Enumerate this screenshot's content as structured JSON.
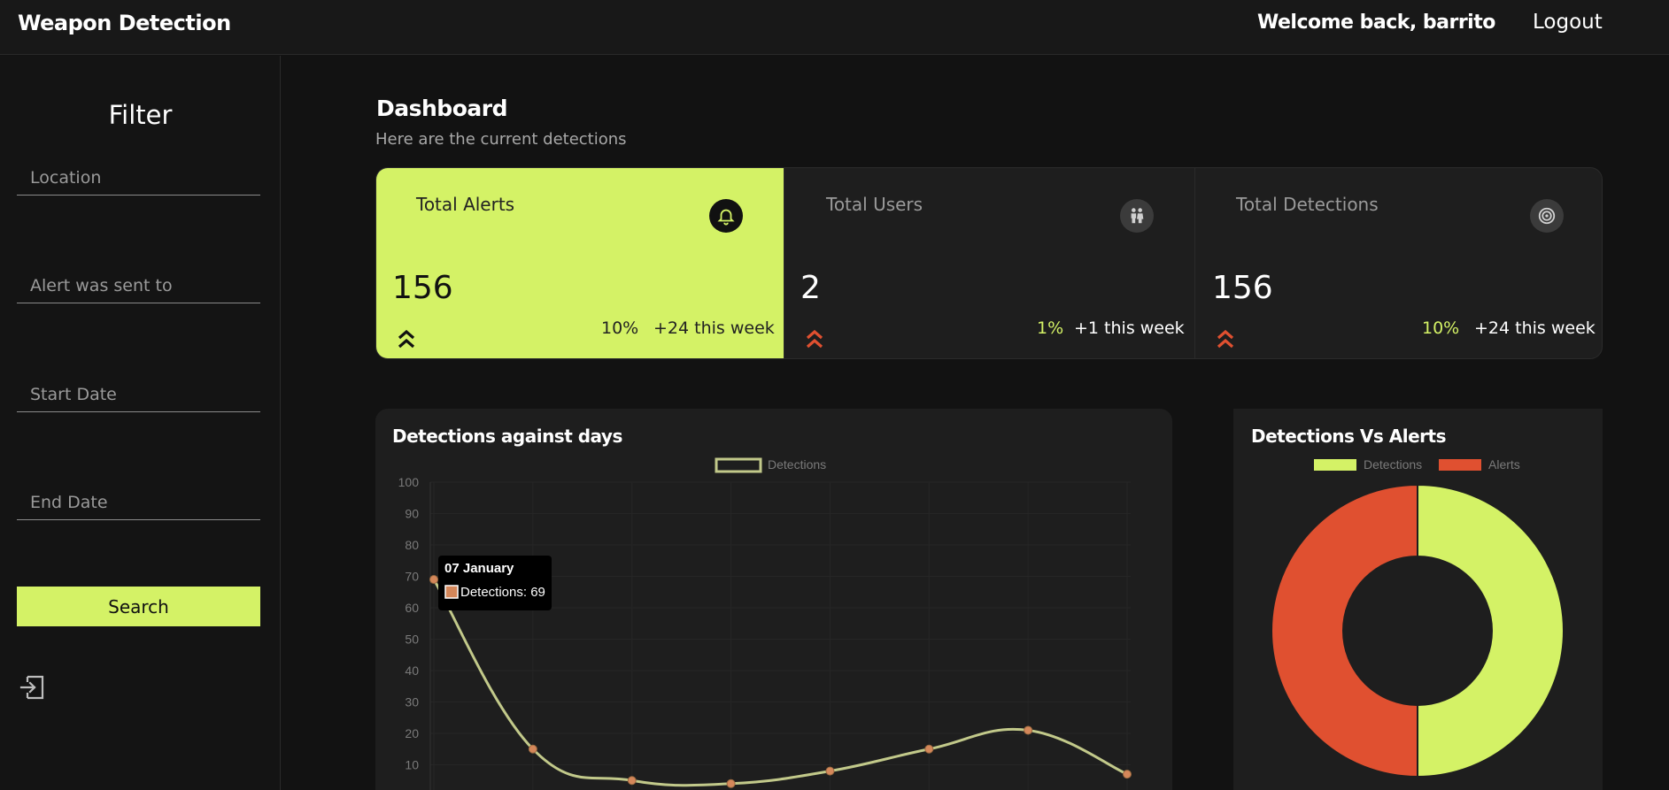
{
  "header": {
    "brand": "Weapon Detection",
    "welcome": "Welcome back, barrito",
    "logout": "Logout"
  },
  "sidebar": {
    "title": "Filter",
    "fields": [
      {
        "placeholder": "Location",
        "value": ""
      },
      {
        "placeholder": "Alert was sent to",
        "value": ""
      },
      {
        "placeholder": "Start Date",
        "value": ""
      },
      {
        "placeholder": "End Date",
        "value": ""
      }
    ],
    "search_label": "Search",
    "exit_icon": "sign-in-icon"
  },
  "main": {
    "title": "Dashboard",
    "subtitle": "Here are the current detections"
  },
  "stats": [
    {
      "label": "Total Alerts",
      "value": "156",
      "pct": "10%",
      "week": "+24 this week",
      "icon": "bell-icon",
      "trend": "double-chevron-up-icon"
    },
    {
      "label": "Total Users",
      "value": "2",
      "pct": "1%",
      "week": "+1 this week",
      "icon": "users-icon",
      "trend": "double-chevron-up-icon"
    },
    {
      "label": "Total Detections",
      "value": "156",
      "pct": "10%",
      "week": "+24 this week",
      "icon": "target-icon",
      "trend": "double-chevron-up-icon"
    }
  ],
  "colors": {
    "accent": "#d4f266",
    "alert": "#e05030",
    "line": "#c2c98a",
    "point": "#d4875a"
  },
  "line_panel": {
    "title": "Detections against days",
    "tooltip": {
      "title": "07  January",
      "text": "Detections: 69"
    }
  },
  "donut_panel": {
    "title": "Detections Vs Alerts"
  },
  "chart_data": [
    {
      "type": "line",
      "title": "Detections against days",
      "series": [
        {
          "name": "Detections",
          "values": [
            69,
            15,
            5,
            4,
            8,
            15,
            21,
            7
          ]
        }
      ],
      "x": [
        0,
        1,
        2,
        3,
        4,
        5,
        6,
        7
      ],
      "ylim": [
        0,
        100
      ],
      "yticks": [
        "100",
        "90",
        "80",
        "70",
        "60",
        "50",
        "40",
        "30",
        "20",
        "10"
      ],
      "legend": "top-center",
      "grid": true
    },
    {
      "type": "pie",
      "title": "Detections Vs Alerts",
      "categories": [
        "Detections",
        "Alerts"
      ],
      "values": [
        156,
        156
      ],
      "legend": "top-center"
    }
  ]
}
